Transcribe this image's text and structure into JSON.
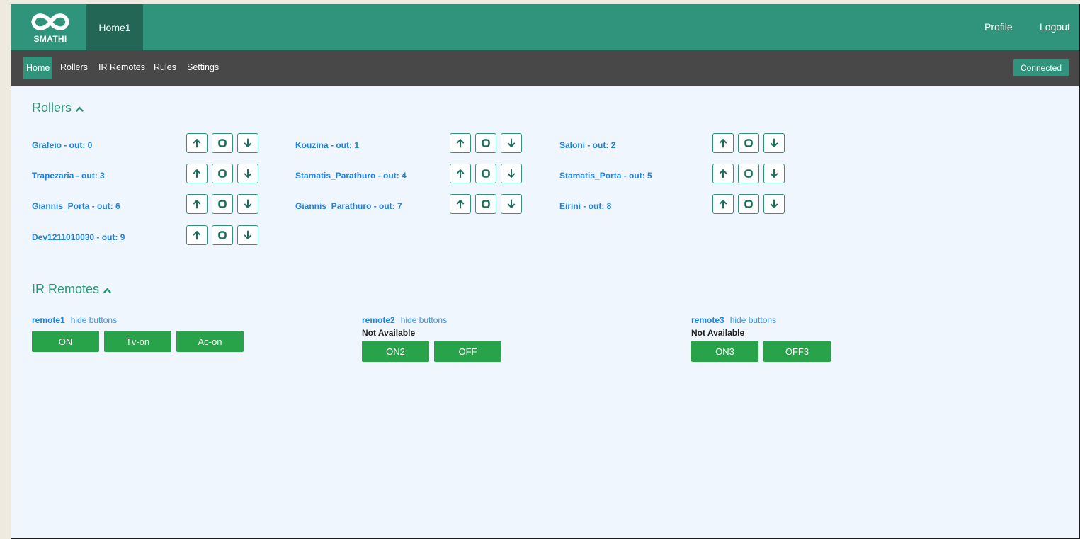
{
  "brand": {
    "logo_text": "SMATHI",
    "color": "#30947c"
  },
  "topbar": {
    "home_tab": "Home1",
    "profile": "Profile",
    "logout": "Logout"
  },
  "nav": {
    "items": [
      "Home",
      "Rollers",
      "IR Remotes",
      "Rules",
      "Settings"
    ],
    "active": "Home",
    "status": "Connected"
  },
  "rollers": {
    "title": "Rollers",
    "items": [
      {
        "name": "Grafeio - out: 0"
      },
      {
        "name": "Kouzina - out: 1"
      },
      {
        "name": "Saloni - out: 2"
      },
      {
        "name": "Trapezaria - out: 3"
      },
      {
        "name": "Stamatis_Parathuro - out: 4"
      },
      {
        "name": "Stamatis_Porta - out: 5"
      },
      {
        "name": "Giannis_Porta - out: 6"
      },
      {
        "name": "Giannis_Parathuro - out: 7"
      },
      {
        "name": "Eirini - out: 8"
      },
      {
        "name": "Dev1211010030 - out: 9"
      }
    ],
    "button_icons": [
      "arrow-up-icon",
      "stop-icon",
      "arrow-down-icon"
    ]
  },
  "remotes": {
    "title": "IR Remotes",
    "toggle_label": "hide buttons",
    "items": [
      {
        "name": "remote1",
        "status": "",
        "buttons": [
          "ON",
          "Tv-on",
          "Ac-on"
        ]
      },
      {
        "name": "remote2",
        "status": "Not Available",
        "buttons": [
          "ON2",
          "OFF"
        ]
      },
      {
        "name": "remote3",
        "status": "Not Available",
        "buttons": [
          "ON3",
          "OFF3"
        ]
      }
    ]
  },
  "colors": {
    "teal": "#30947c",
    "dark_teal": "#236655",
    "nav_bg": "#484848",
    "link_blue": "#1e82e0",
    "button_green": "#28a34a",
    "page_bg": "#eff6fd"
  }
}
